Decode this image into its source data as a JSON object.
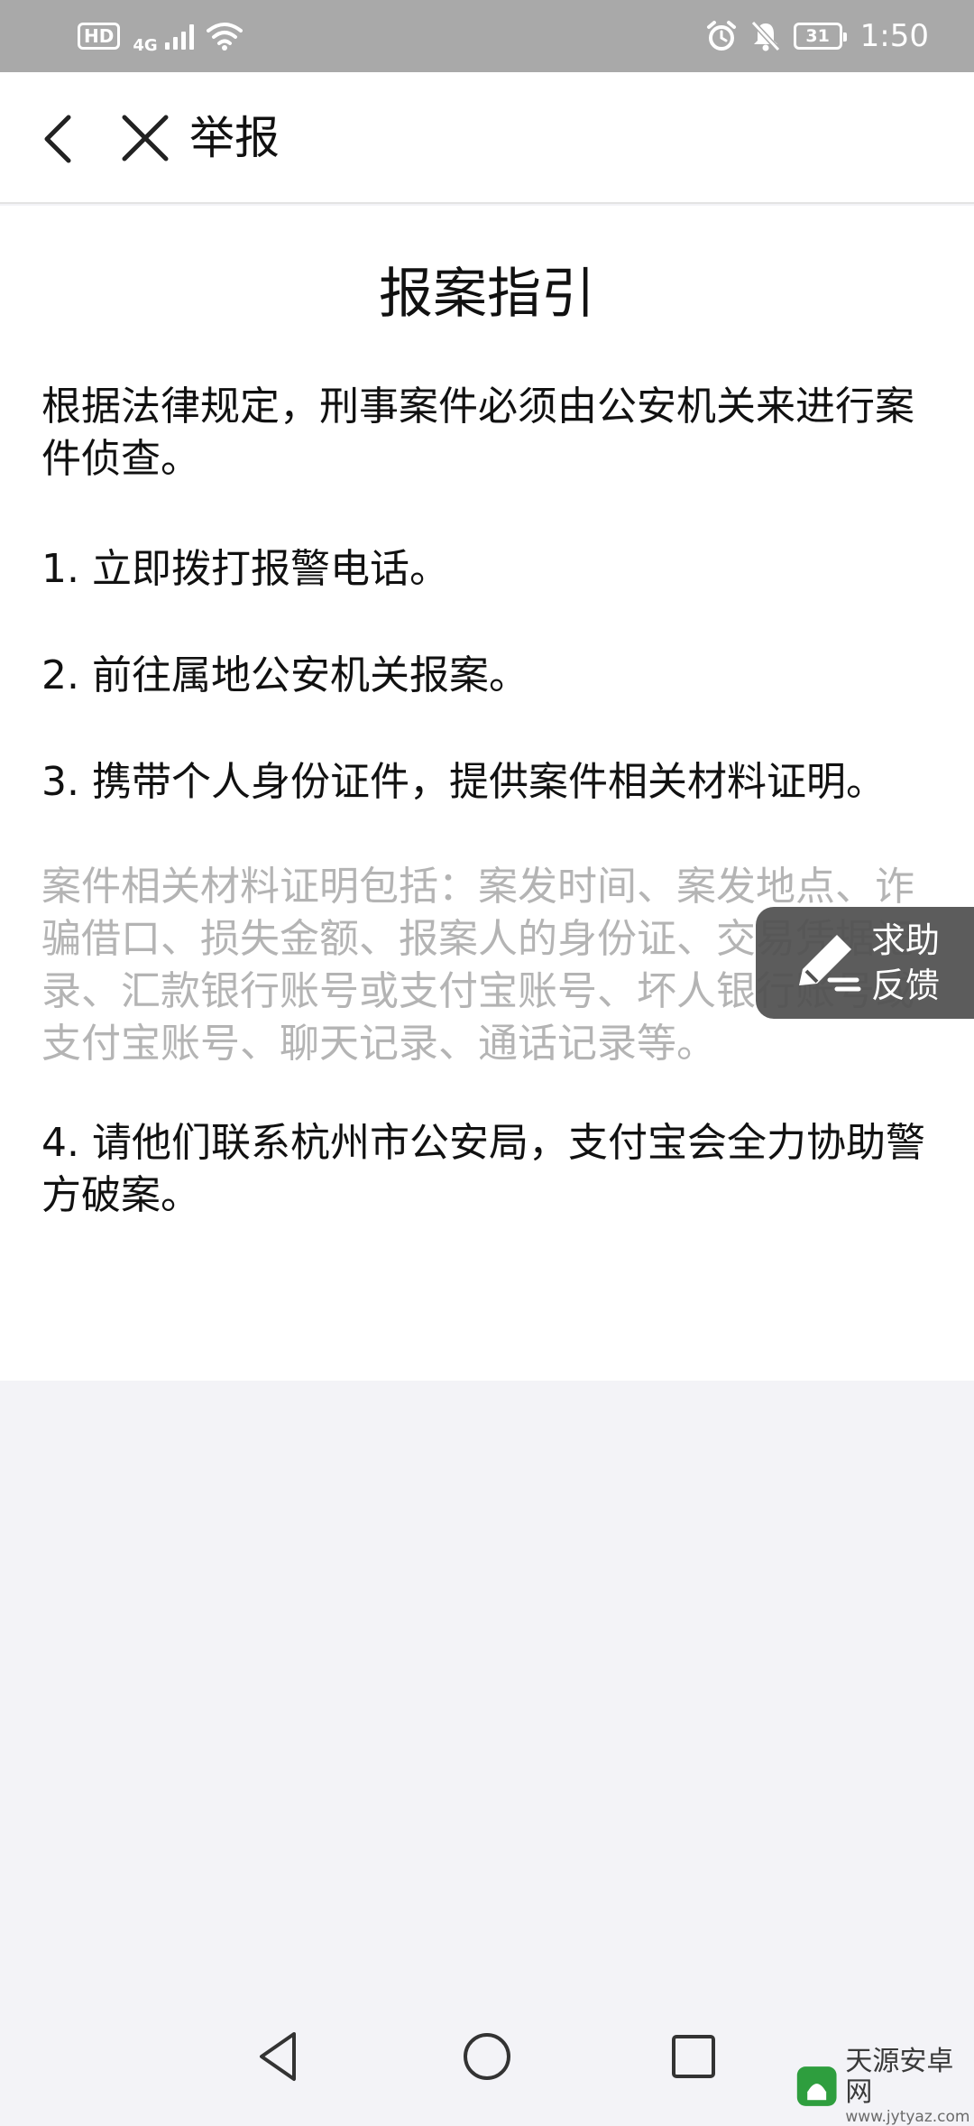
{
  "status_bar": {
    "hd": "HD",
    "network": "4G",
    "battery": "31",
    "time": "1:50",
    "icons": [
      "signal-icon",
      "wifi-icon",
      "alarm-icon",
      "mute-icon",
      "battery-icon"
    ]
  },
  "nav": {
    "title": "举报",
    "icons": [
      "back-icon",
      "close-icon"
    ]
  },
  "doc": {
    "title": "报案指引",
    "intro": "根据法律规定，刑事案件必须由公安机关来进行案件侦查。",
    "step1": "1. 立即拨打报警电话。",
    "step2": "2. 前往属地公安机关报案。",
    "step3": "3. 携带个人身份证件，提供案件相关材料证明。",
    "step3_note": "案件相关材料证明包括：案发时间、案发地点、诈骗借口、损失金额、报案人的身份证、交易凭据记录、汇款银行账号或支付宝账号、坏人银行账号或支付宝账号、聊天记录、通话记录等。",
    "step4": "4. 请他们联系杭州市公安局，支付宝会全力协助警方破案。"
  },
  "float_help": {
    "label_line1": "求助",
    "label_line2": "反馈",
    "icon": "pencil-icon"
  },
  "bottom_nav": {
    "icons": [
      "back-triangle-icon",
      "home-circle-icon",
      "recents-square-icon"
    ]
  },
  "watermark": {
    "text": "天源安卓网",
    "url": "www.jytyaz.com"
  },
  "colors": {
    "status_bar_bg": "#a9a9a9",
    "page_bg": "#f3f3f7",
    "content_bg": "#ffffff",
    "note_text": "#b4b4b4",
    "float_bg": "#505050"
  }
}
